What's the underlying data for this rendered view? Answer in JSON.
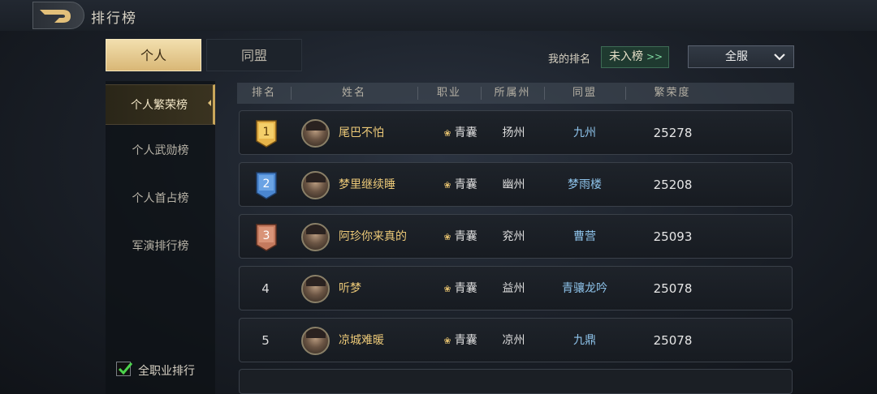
{
  "header": {
    "title": "排行榜"
  },
  "tabs": [
    {
      "label": "个人"
    },
    {
      "label": "同盟"
    }
  ],
  "my_rank": {
    "label": "我的排名",
    "value": "未入榜",
    "arrow": ">>"
  },
  "server_filter": {
    "selected": "全服"
  },
  "sidebar": {
    "items": [
      {
        "label": "个人繁荣榜"
      },
      {
        "label": "个人武勋榜"
      },
      {
        "label": "个人首占榜"
      },
      {
        "label": "军演排行榜"
      }
    ],
    "checkbox_label": "全职业排行",
    "checkbox_checked": true
  },
  "table": {
    "columns": [
      "排名",
      "姓名",
      "职业",
      "所属州",
      "同盟",
      "繁荣度"
    ],
    "rows": [
      {
        "rank": "1",
        "name": "尾巴不怕",
        "job": "青囊",
        "province": "扬州",
        "alliance": "九州",
        "score": "25278"
      },
      {
        "rank": "2",
        "name": "梦里继续睡",
        "job": "青囊",
        "province": "幽州",
        "alliance": "梦雨楼",
        "score": "25208"
      },
      {
        "rank": "3",
        "name": "阿珍你来真的",
        "job": "青囊",
        "province": "兖州",
        "alliance": "曹营",
        "score": "25093"
      },
      {
        "rank": "4",
        "name": "听梦",
        "job": "青囊",
        "province": "益州",
        "alliance": "青骧龙吟",
        "score": "25078"
      },
      {
        "rank": "5",
        "name": "凉城难暖",
        "job": "青囊",
        "province": "凉州",
        "alliance": "九鼎",
        "score": "25078"
      }
    ]
  },
  "colors": {
    "gold": "#e8b54a",
    "silver_blue": "#4a86d0",
    "bronze": "#c47a5e",
    "accent_text": "#ecc978",
    "alliance_text": "#8ec3ea"
  },
  "icons": {
    "back": "back-arrow-icon",
    "dropdown": "chevron-down-icon",
    "job": "lotus-icon",
    "check": "check-icon"
  }
}
